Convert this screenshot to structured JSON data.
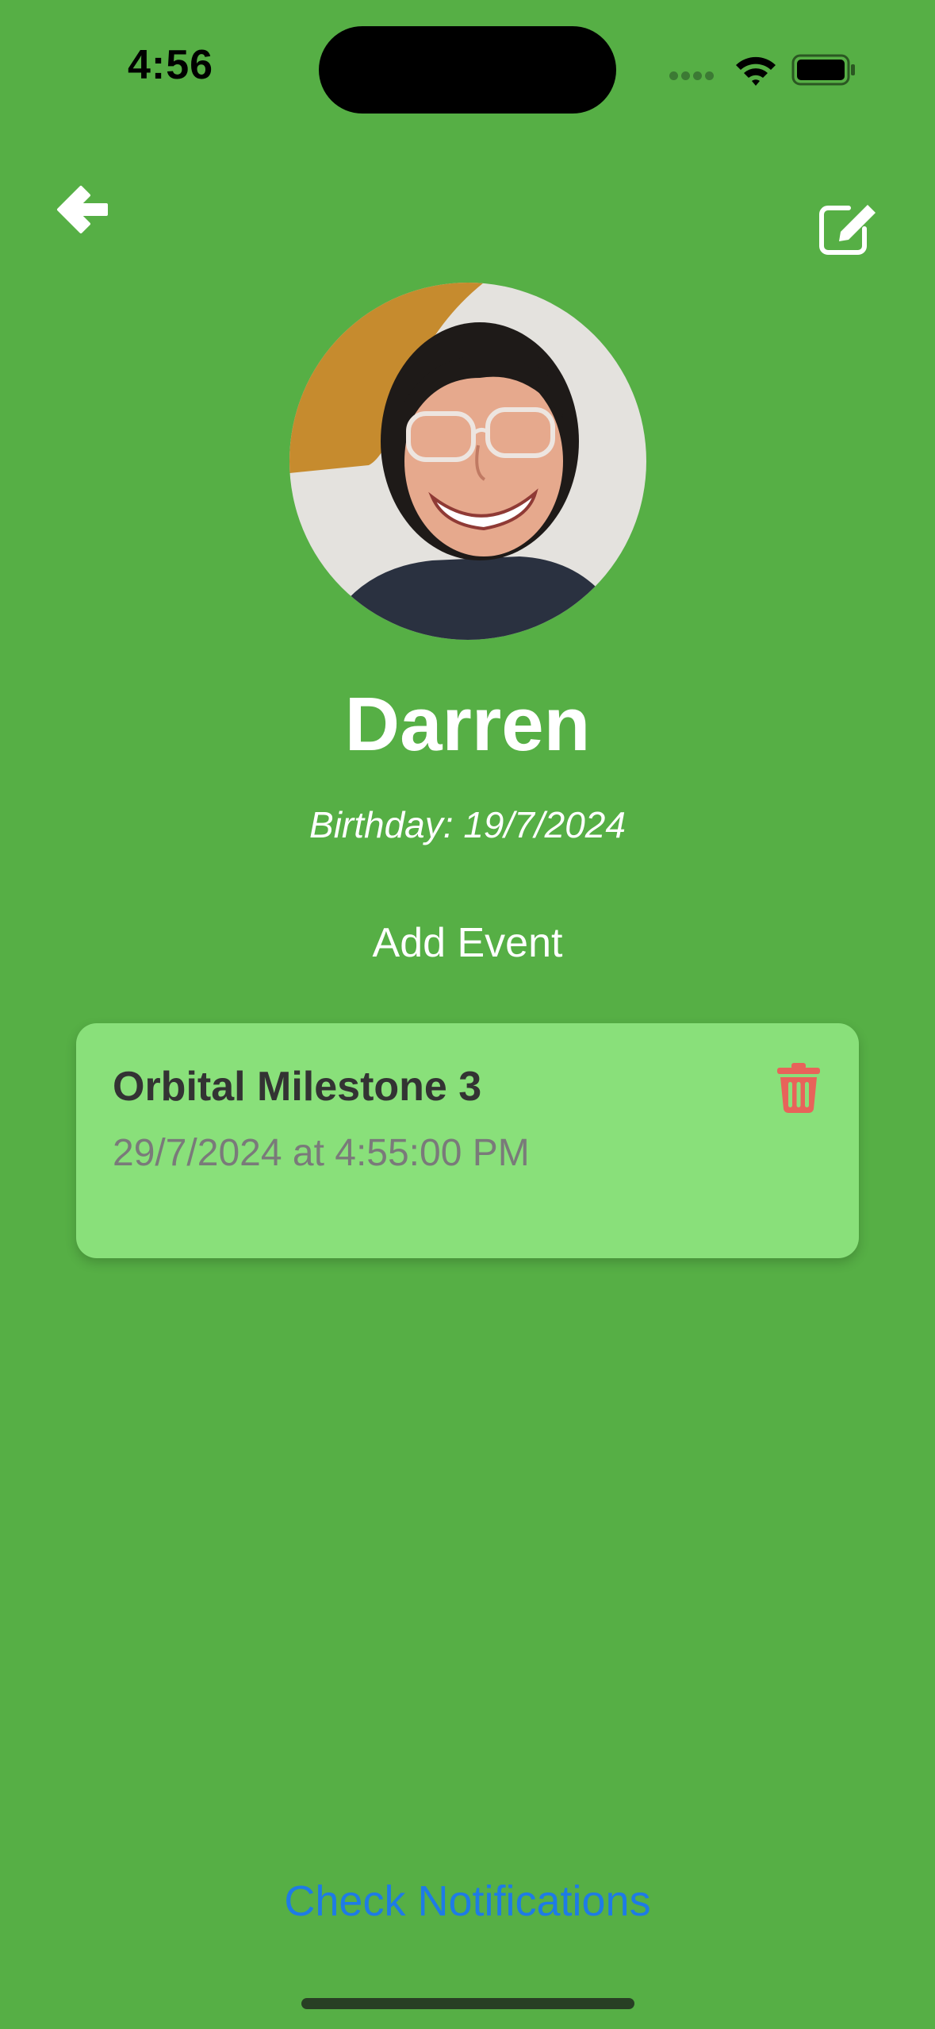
{
  "status_bar": {
    "time": "4:56",
    "signal_icon": "cellular-signal-icon",
    "wifi_icon": "wifi-icon",
    "battery_icon": "battery-icon"
  },
  "header": {
    "back_icon": "arrow-left-icon",
    "edit_icon": "edit-square-pencil-icon"
  },
  "profile": {
    "name": "Darren",
    "birthday": "Birthday: 19/7/2024"
  },
  "actions": {
    "add_event_label": "Add Event",
    "check_notifications_label": "Check Notifications"
  },
  "events": [
    {
      "title": "Orbital Milestone 3",
      "datetime": "29/7/2024 at 4:55:00 PM",
      "delete_icon": "trash-icon"
    }
  ],
  "colors": {
    "background": "#56AF45",
    "card": "#89E07A",
    "delete": "#E8635A",
    "link": "#1E7BE6"
  }
}
